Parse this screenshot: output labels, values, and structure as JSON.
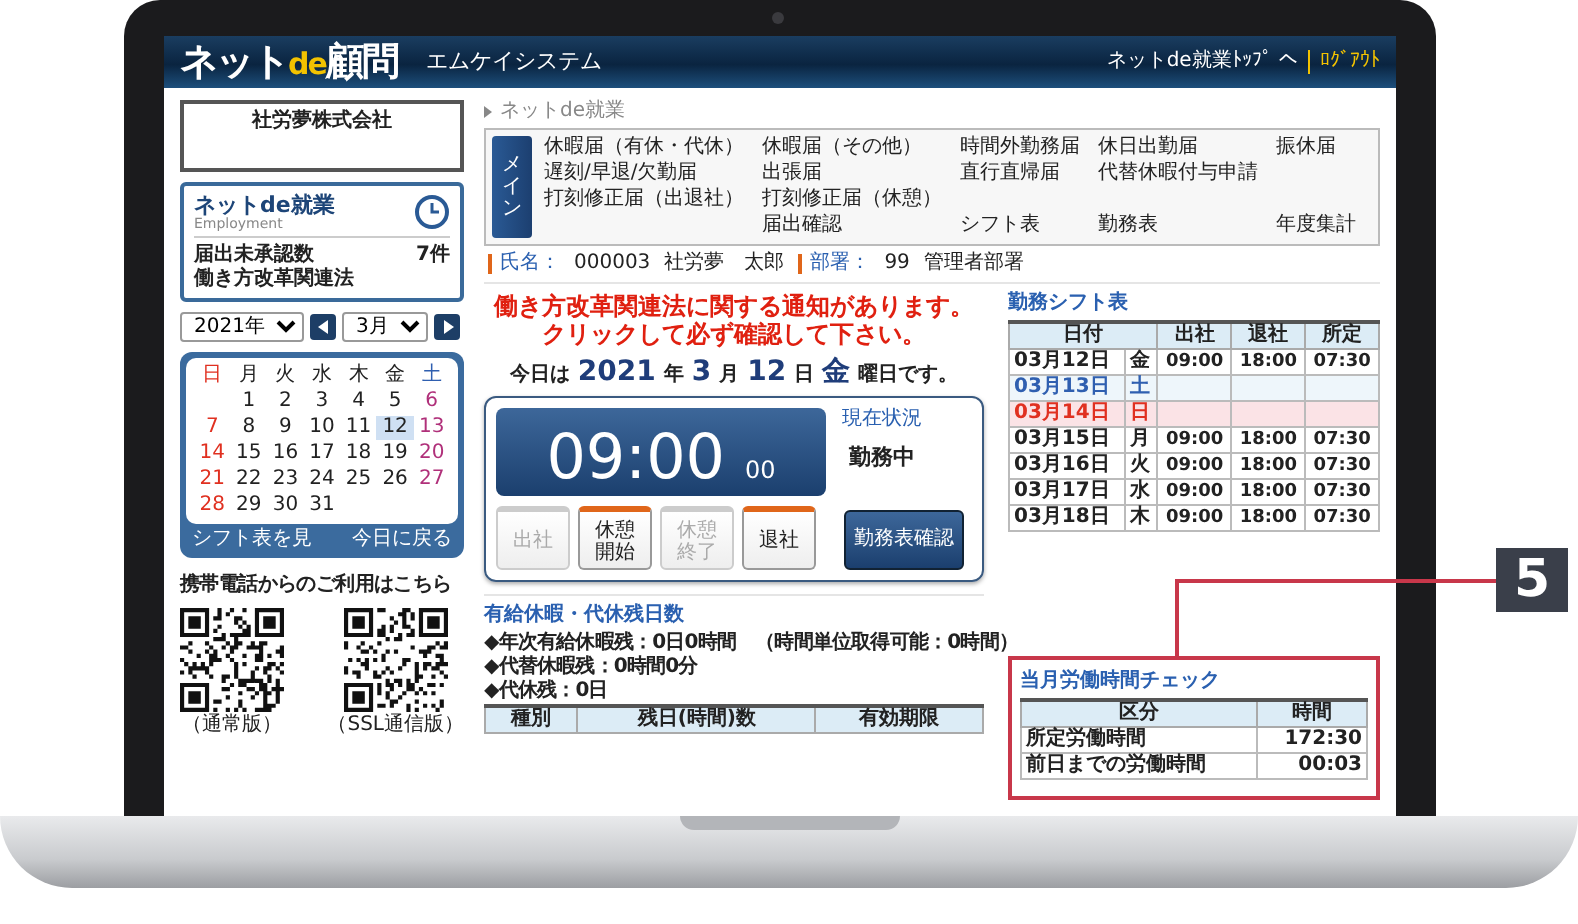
{
  "header": {
    "logo_prefix": "ネット",
    "logo_accent": "de",
    "logo_suffix": "顧問",
    "company": "エムケイシステム",
    "top_link": "ネットde就業ﾄｯﾌﾟ へ",
    "logout_link": "ﾛｸﾞｱｳﾄ"
  },
  "sidebar": {
    "company": "社労夢株式会社",
    "panel": {
      "title": "ネットde就業",
      "subtitle": "Employment",
      "rows": [
        {
          "label": "届出未承認数",
          "value": "7件"
        },
        {
          "label": "働き方改革関連法"
        }
      ]
    },
    "calendar": {
      "year": "2021年",
      "month": "3月",
      "weekdays": [
        {
          "label": "日",
          "kind": "sunday"
        },
        {
          "label": "月",
          "kind": "weekday"
        },
        {
          "label": "火",
          "kind": "weekday"
        },
        {
          "label": "水",
          "kind": "weekday"
        },
        {
          "label": "木",
          "kind": "weekday"
        },
        {
          "label": "金",
          "kind": "weekday"
        },
        {
          "label": "土",
          "kind": "saturday"
        }
      ],
      "weeks": [
        [
          {
            "day": "1",
            "kind": "weekday",
            "selected": false
          },
          {
            "day": "2",
            "kind": "weekday",
            "selected": false
          },
          {
            "day": "3",
            "kind": "weekday",
            "selected": false
          },
          {
            "day": "4",
            "kind": "weekday",
            "selected": false
          },
          {
            "day": "5",
            "kind": "weekday",
            "selected": false
          },
          {
            "day": "6",
            "kind": "saturday",
            "selected": false
          }
        ],
        [
          {
            "day": "7",
            "kind": "sunday",
            "selected": false
          },
          {
            "day": "8",
            "kind": "weekday",
            "selected": false
          },
          {
            "day": "9",
            "kind": "weekday",
            "selected": false
          },
          {
            "day": "10",
            "kind": "weekday",
            "selected": false
          },
          {
            "day": "11",
            "kind": "weekday",
            "selected": false
          },
          {
            "day": "12",
            "kind": "weekday",
            "selected": true
          },
          {
            "day": "13",
            "kind": "saturday",
            "selected": false
          }
        ],
        [
          {
            "day": "14",
            "kind": "sunday",
            "selected": false
          },
          {
            "day": "15",
            "kind": "weekday",
            "selected": false
          },
          {
            "day": "16",
            "kind": "weekday",
            "selected": false
          },
          {
            "day": "17",
            "kind": "weekday",
            "selected": false
          },
          {
            "day": "18",
            "kind": "weekday",
            "selected": false
          },
          {
            "day": "19",
            "kind": "weekday",
            "selected": false
          },
          {
            "day": "20",
            "kind": "saturday",
            "selected": false
          }
        ],
        [
          {
            "day": "21",
            "kind": "sunday",
            "selected": false
          },
          {
            "day": "22",
            "kind": "weekday",
            "selected": false
          },
          {
            "day": "23",
            "kind": "weekday",
            "selected": false
          },
          {
            "day": "24",
            "kind": "weekday",
            "selected": false
          },
          {
            "day": "25",
            "kind": "weekday",
            "selected": false
          },
          {
            "day": "26",
            "kind": "weekday",
            "selected": false
          },
          {
            "day": "27",
            "kind": "saturday",
            "selected": false
          }
        ],
        [
          {
            "day": "28",
            "kind": "sunday",
            "selected": false
          },
          {
            "day": "29",
            "kind": "weekday",
            "selected": false
          },
          {
            "day": "30",
            "kind": "weekday",
            "selected": false
          },
          {
            "day": "31",
            "kind": "weekday",
            "selected": false
          }
        ]
      ],
      "footer_left": "シフト表を見",
      "footer_right": "今日に戻る"
    },
    "mobile": {
      "title": "携帯電話からのご利用はこちら",
      "qr": [
        {
          "caption": "（通常版）"
        },
        {
          "caption": "（SSL通信版）"
        }
      ]
    }
  },
  "breadcrumb": "ネットde就業",
  "menu": {
    "tab": "メイン",
    "first_column": [
      "休暇届（有休・代休）",
      "遅刻/早退/欠勤届",
      "打刻修正届（出退社）"
    ],
    "rows": [
      [
        "休暇届（その他）",
        "時間外勤務届",
        "休日出勤届",
        "振休届"
      ],
      [
        "出張届",
        "直行直帰届",
        "代替休暇付与申請"
      ],
      [
        "打刻修正届（休憩）"
      ],
      [
        "届出確認",
        "シフト表",
        "勤務表",
        "年度集計"
      ]
    ]
  },
  "employee": {
    "name_label": "氏名：",
    "id": "000003",
    "name": "社労夢　太郎",
    "dept_label": "部署：",
    "dept_id": "99",
    "dept": "管理者部署"
  },
  "notice": [
    "働き方改革関連法に関する通知があります。",
    "クリックして必ず確認して下さい。"
  ],
  "today": [
    {
      "text": "今日は",
      "kind": "label"
    },
    {
      "text": "2021",
      "kind": "value"
    },
    {
      "text": "年",
      "kind": "label"
    },
    {
      "text": "3",
      "kind": "value"
    },
    {
      "text": "月",
      "kind": "label"
    },
    {
      "text": "12",
      "kind": "value"
    },
    {
      "text": "日",
      "kind": "label"
    },
    {
      "text": "金",
      "kind": "value"
    },
    {
      "text": "曜日です。",
      "kind": "label"
    }
  ],
  "clock": {
    "time": "09:00",
    "seconds": "00",
    "status_label": "現在状況",
    "status": "勤務中",
    "buttons": [
      {
        "label": "出社",
        "disabled": true
      },
      {
        "label": "休憩開始",
        "disabled": false
      },
      {
        "label": "休憩終了",
        "disabled": true
      },
      {
        "label": "退社",
        "disabled": false
      }
    ],
    "confirm": "勤務表確認"
  },
  "leave": {
    "title": "有給休暇・代休残日数",
    "lines": [
      "◆年次有給休暇残：0日0時間　（時間単位取得可能：0時間）",
      "◆代替休暇残：0時間0分",
      "◆代休残：0日"
    ],
    "columns": [
      "種別",
      "残日(時間)数",
      "有効期限"
    ]
  },
  "shift_table": {
    "title": "勤務シフト表",
    "columns": [
      "日付",
      "出社",
      "退社",
      "所定"
    ],
    "rows": [
      {
        "date": "03月12日",
        "day": "金",
        "kind": "weekday",
        "start": "09:00",
        "end": "18:00",
        "scheduled": "07:30"
      },
      {
        "date": "03月13日",
        "day": "土",
        "kind": "saturday"
      },
      {
        "date": "03月14日",
        "day": "日",
        "kind": "sunday"
      },
      {
        "date": "03月15日",
        "day": "月",
        "kind": "weekday",
        "start": "09:00",
        "end": "18:00",
        "scheduled": "07:30"
      },
      {
        "date": "03月16日",
        "day": "火",
        "kind": "weekday",
        "start": "09:00",
        "end": "18:00",
        "scheduled": "07:30"
      },
      {
        "date": "03月17日",
        "day": "水",
        "kind": "weekday",
        "start": "09:00",
        "end": "18:00",
        "scheduled": "07:30"
      },
      {
        "date": "03月18日",
        "day": "木",
        "kind": "weekday",
        "start": "09:00",
        "end": "18:00",
        "scheduled": "07:30"
      }
    ]
  },
  "hours_check": {
    "title": "当月労働時間チェック",
    "columns": [
      "区分",
      "時間"
    ],
    "rows": [
      [
        "所定労働時間",
        "172:30"
      ],
      [
        "前日までの労働時間",
        "00:03"
      ]
    ]
  },
  "callout": {
    "label": "5"
  }
}
